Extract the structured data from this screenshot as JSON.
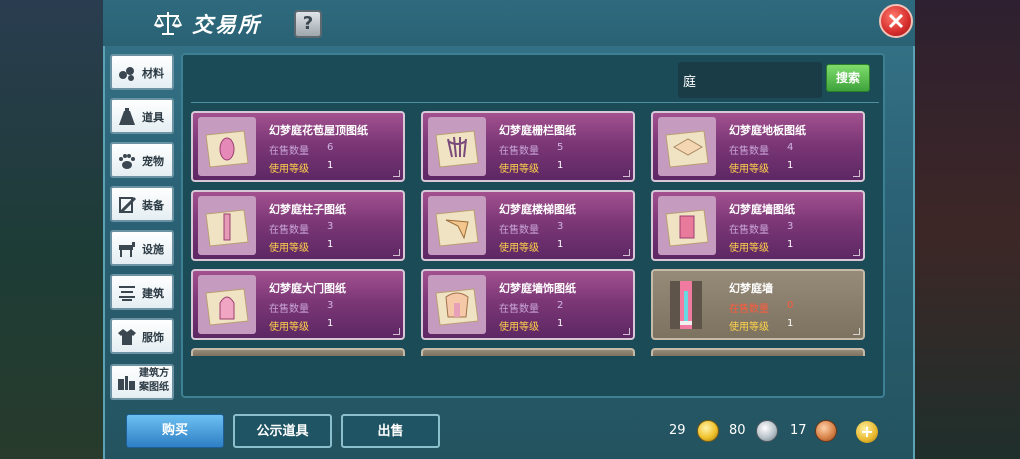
{
  "header": {
    "title": "交易所",
    "help_label": "?"
  },
  "sidebar": {
    "items": [
      {
        "label": "材料",
        "icon": "materials-icon"
      },
      {
        "label": "道具",
        "icon": "flask-icon"
      },
      {
        "label": "宠物",
        "icon": "paw-icon"
      },
      {
        "label": "装备",
        "icon": "equipment-icon"
      },
      {
        "label": "设施",
        "icon": "facility-icon"
      },
      {
        "label": "建筑",
        "icon": "building-icon"
      },
      {
        "label": "服饰",
        "icon": "clothing-icon"
      },
      {
        "label": "建筑方案图纸",
        "icon": "blueprint-icon"
      }
    ]
  },
  "search": {
    "value": "庭",
    "button_label": "搜索"
  },
  "listing": {
    "count_label": "在售数量",
    "level_label": "使用等级",
    "items": [
      {
        "name": "幻梦庭花苞屋顶图纸",
        "count": "6",
        "level": "1",
        "style": "purple"
      },
      {
        "name": "幻梦庭栅栏图纸",
        "count": "5",
        "level": "1",
        "style": "purple"
      },
      {
        "name": "幻梦庭地板图纸",
        "count": "4",
        "level": "1",
        "style": "purple"
      },
      {
        "name": "幻梦庭柱子图纸",
        "count": "3",
        "level": "1",
        "style": "purple"
      },
      {
        "name": "幻梦庭楼梯图纸",
        "count": "3",
        "level": "1",
        "style": "purple"
      },
      {
        "name": "幻梦庭墙图纸",
        "count": "3",
        "level": "1",
        "style": "purple"
      },
      {
        "name": "幻梦庭大门图纸",
        "count": "3",
        "level": "1",
        "style": "purple"
      },
      {
        "name": "幻梦庭墙饰图纸",
        "count": "2",
        "level": "1",
        "style": "purple"
      },
      {
        "name": "幻梦庭墙",
        "count": "0",
        "level": "1",
        "style": "grey"
      }
    ]
  },
  "footer": {
    "buy_label": "购买",
    "showcase_label": "公示道具",
    "sell_label": "出售",
    "gold": "29",
    "silver": "80",
    "copper": "17",
    "add_label": "+"
  },
  "colors": {
    "card_purple": "#7c3777",
    "card_grey": "#7d7260",
    "count_zero": "#ff5a3c",
    "level_label": "#ffd34a",
    "search_button": "#3ea23b",
    "buy_button": "#2e7fc4"
  }
}
